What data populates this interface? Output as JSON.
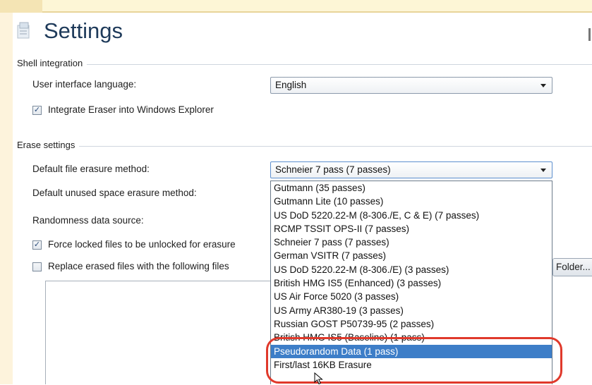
{
  "page": {
    "title": "Settings"
  },
  "shell_integration": {
    "group_label": "Shell integration",
    "ui_language_label": "User interface language:",
    "ui_language_value": "English",
    "integrate_explorer_label": "Integrate Eraser into Windows Explorer",
    "integrate_explorer_checked": true
  },
  "erase_settings": {
    "group_label": "Erase settings",
    "default_file_method_label": "Default file erasure method:",
    "default_file_method_value": "Schneier 7 pass (7 passes)",
    "default_unused_method_label": "Default unused space erasure method:",
    "randomness_label": "Randomness data source:",
    "force_unlock_label": "Force locked files to be unlocked for erasure",
    "force_unlock_checked": true,
    "replace_files_label": "Replace erased files with the following files",
    "replace_files_checked": false,
    "folder_button_label": "Folder..."
  },
  "dropdown": {
    "selected_index": 15,
    "options": [
      "Gutmann (35 passes)",
      "Gutmann Lite (10 passes)",
      "US DoD 5220.22-M (8-306./E, C & E) (7 passes)",
      "RCMP TSSIT OPS-II (7 passes)",
      "Schneier 7 pass (7 passes)",
      "German VSITR (7 passes)",
      "US DoD 5220.22-M (8-306./E) (3 passes)",
      "British HMG IS5 (Enhanced) (3 passes)",
      "US Air Force 5020 (3 passes)",
      "US Army AR380-19 (3 passes)",
      "Russian GOST P50739-95 (2 passes)",
      "British HMG IS5 (Baseline) (1 pass)",
      "Pseudorandom Data (1 pass)",
      "First/last 16KB Erasure"
    ]
  },
  "colors": {
    "selection": "#3d7ec8",
    "highlight_ring": "#e0392b",
    "title": "#1e3a5a"
  }
}
